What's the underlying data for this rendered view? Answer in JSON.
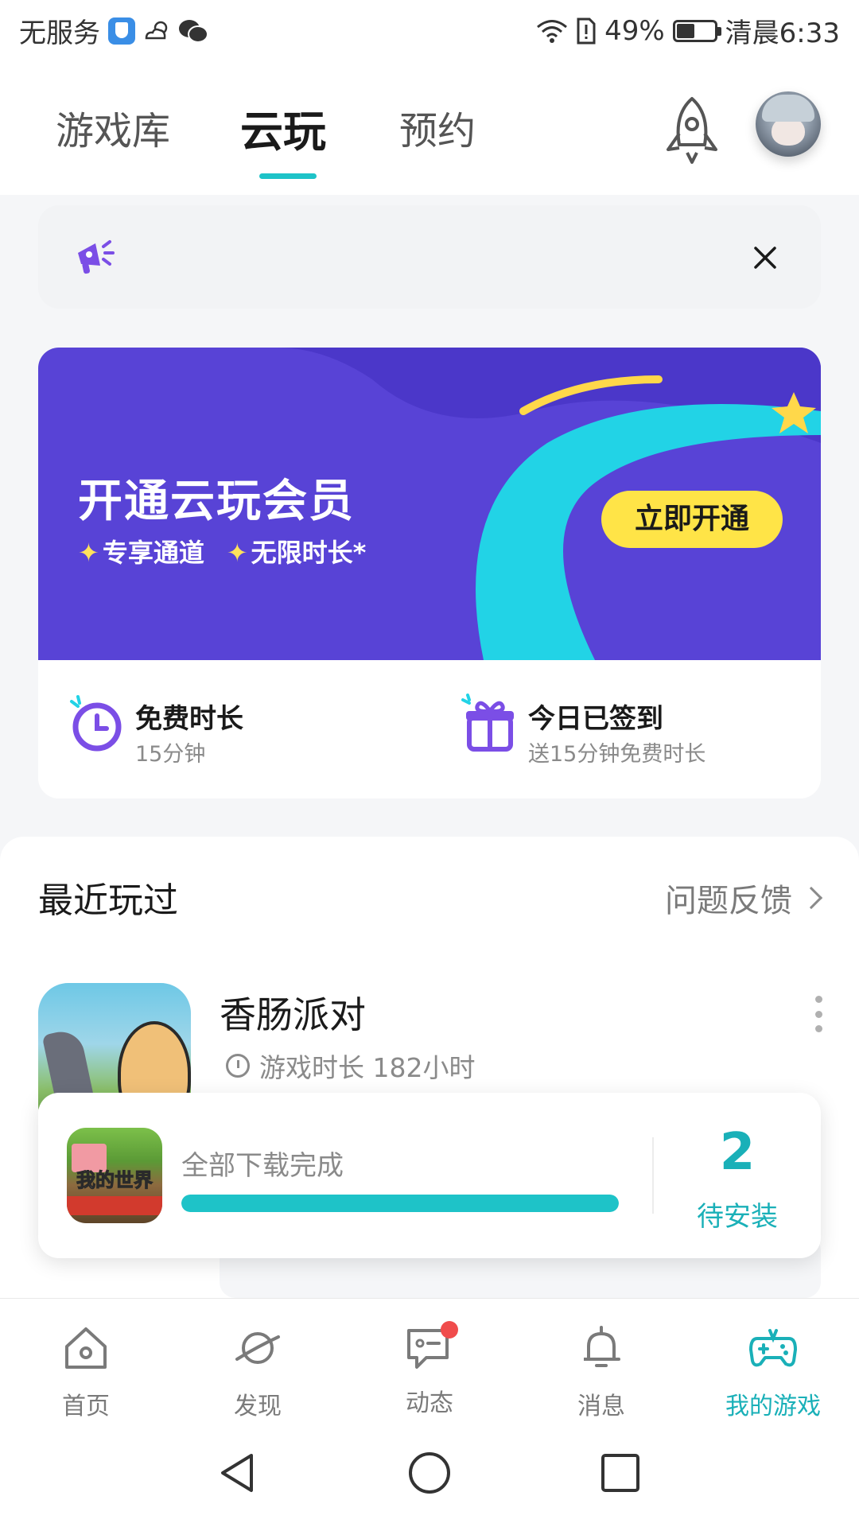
{
  "status_bar": {
    "carrier": "无服务",
    "battery_percent": "49%",
    "battery_level": 0.49,
    "time": "清晨6:33"
  },
  "header": {
    "tabs": [
      {
        "label": "游戏库",
        "active": false
      },
      {
        "label": "云玩",
        "active": true
      },
      {
        "label": "预约",
        "active": false
      }
    ],
    "icons": [
      "rocket-icon",
      "avatar"
    ]
  },
  "notice": {
    "icon": "megaphone-icon",
    "close_icon": "close-icon"
  },
  "member_banner": {
    "title": "开通云玩会员",
    "perks": [
      "专享通道",
      "无限时长*"
    ],
    "button_label": "立即开通",
    "colors": {
      "background": "#5843d6",
      "button": "#ffe447",
      "accent": "#22d3e6"
    }
  },
  "stats": {
    "free_time": {
      "title": "免费时长",
      "value": "15分钟",
      "icon": "clock-icon"
    },
    "checkin": {
      "title": "今日已签到",
      "value": "送15分钟免费时长",
      "icon": "gift-icon"
    }
  },
  "recent": {
    "title": "最近玩过",
    "feedback_label": "问题反馈",
    "game": {
      "name": "香肠派对",
      "play_time": "游戏时长 182小时"
    }
  },
  "download": {
    "status": "全部下载完成",
    "progress": 1.0,
    "count": "2",
    "pending_label": "待安装",
    "game_icon_text": "我的世界"
  },
  "bottom_nav": {
    "items": [
      {
        "label": "首页",
        "icon": "home-icon",
        "active": false
      },
      {
        "label": "发现",
        "icon": "planet-icon",
        "active": false
      },
      {
        "label": "动态",
        "icon": "chat-icon",
        "active": false,
        "badge": true
      },
      {
        "label": "消息",
        "icon": "bell-icon",
        "active": false
      },
      {
        "label": "我的游戏",
        "icon": "gamepad-icon",
        "active": true
      }
    ],
    "accent": "#1ab0b8"
  },
  "system_nav": [
    "back-icon",
    "home-circle-icon",
    "recents-icon"
  ]
}
